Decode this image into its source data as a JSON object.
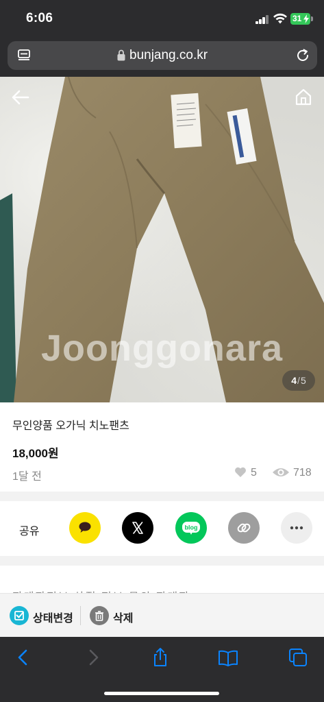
{
  "status_bar": {
    "time": "6:06",
    "battery_level": "31",
    "icons": [
      "signal-icon",
      "wifi-icon",
      "battery-icon"
    ]
  },
  "browser": {
    "url": "bunjang.co.kr",
    "icons": [
      "reader-icon",
      "lock-icon",
      "reload-icon"
    ]
  },
  "photo": {
    "watermark": "Joonggonara",
    "current_index": "4",
    "separator": "/",
    "total": "5",
    "icons": [
      "back-arrow-icon",
      "home-icon"
    ]
  },
  "product": {
    "title": "무인양품 오가닉 치노팬츠",
    "price": "18,000원",
    "posted": "1달 전",
    "likes": "5",
    "views": "718"
  },
  "share": {
    "label": "공유",
    "buttons": [
      {
        "name": "kakaotalk",
        "icon": "kakao-speech-bubble-icon",
        "color": "#fae100"
      },
      {
        "name": "x",
        "icon": "x-logo-icon",
        "color": "#000000"
      },
      {
        "name": "naver-blog",
        "icon": "blog-icon",
        "color": "#03c75a",
        "text": "blog"
      },
      {
        "name": "copy-link",
        "icon": "link-icon",
        "color": "#9e9e9e"
      },
      {
        "name": "more",
        "icon": "more-dots-icon",
        "color": "#eeeeee"
      }
    ]
  },
  "below_content": {
    "partial_text": "판매자정보  상점 정보  문의  판매자"
  },
  "actions": {
    "status_change": "상태변경",
    "delete": "삭제",
    "accent": "#19b6d4"
  },
  "safari_toolbar": {
    "icons": [
      "back-icon",
      "forward-icon",
      "share-icon",
      "bookmarks-icon",
      "tabs-icon"
    ],
    "accent": "#0a84ff"
  }
}
